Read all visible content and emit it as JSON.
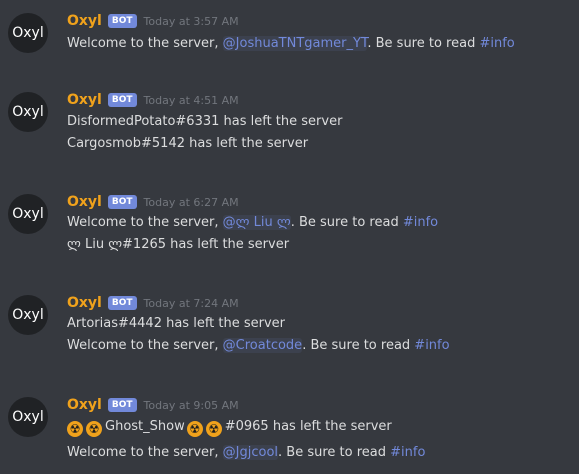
{
  "messages": [
    {
      "avatar_text": "Oxyl",
      "username": "Oxyl",
      "badge": "BOT",
      "timestamp": "Today at 3:57 AM",
      "lines": [
        {
          "type": "welcome",
          "prefix": "Welcome to the server, ",
          "mention": "@JoshuaTNTgamer_YT",
          "middle": ". Be sure to read ",
          "channel": "#info"
        }
      ]
    },
    {
      "avatar_text": "Oxyl",
      "username": "Oxyl",
      "badge": "BOT",
      "timestamp": "Today at 4:51 AM",
      "lines": [
        {
          "type": "left",
          "text": "DisformedPotato#6331 has left the server"
        },
        {
          "type": "left",
          "text": "Cargosmob#5142 has left the server"
        }
      ]
    },
    {
      "avatar_text": "Oxyl",
      "username": "Oxyl",
      "badge": "BOT",
      "timestamp": "Today at 6:27 AM",
      "lines": [
        {
          "type": "welcome",
          "prefix": "Welcome to the server, ",
          "mention": "@ლ Liu ლ",
          "middle": ". Be sure to read ",
          "channel": "#info"
        },
        {
          "type": "left",
          "text": "ლ Liu ლ#1265 has left the server"
        }
      ]
    },
    {
      "avatar_text": "Oxyl",
      "username": "Oxyl",
      "badge": "BOT",
      "timestamp": "Today at 7:24 AM",
      "lines": [
        {
          "type": "left",
          "text": "Artorias#4442 has left the server"
        },
        {
          "type": "welcome",
          "prefix": "Welcome to the server, ",
          "mention": "@Croatcode",
          "middle": ". Be sure to read ",
          "channel": "#info"
        }
      ]
    },
    {
      "avatar_text": "Oxyl",
      "username": "Oxyl",
      "badge": "BOT",
      "timestamp": "Today at 9:05 AM",
      "lines": [
        {
          "type": "emoji",
          "name": "Ghost_Show",
          "suffix": "#0965 has left the server"
        },
        {
          "type": "welcome",
          "prefix": "Welcome to the server, ",
          "mention": "@Jgjcool",
          "middle": ". Be sure to read ",
          "channel": "#info"
        }
      ]
    }
  ],
  "colors": {
    "background": "#36393f",
    "username": "#f0a21c",
    "bot_badge": "#7289da",
    "mention": "#7289da",
    "timestamp": "#72767d",
    "text": "#dcddde"
  },
  "icons": {
    "hazard": "☢"
  }
}
